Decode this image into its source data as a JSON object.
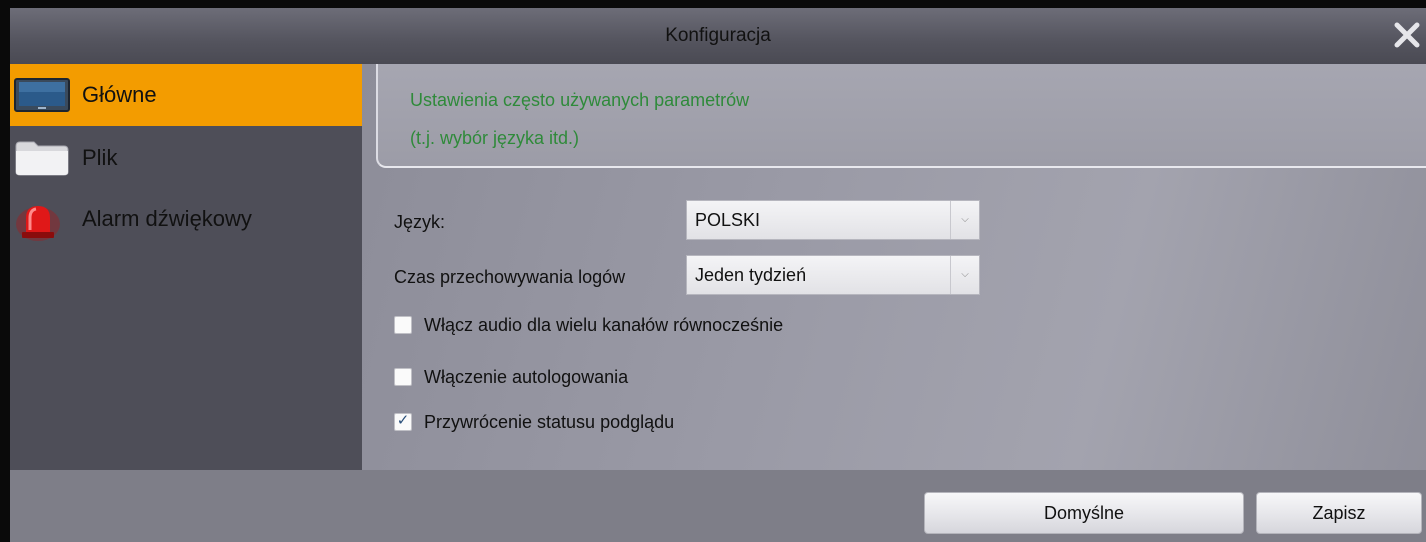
{
  "window": {
    "title": "Konfiguracja",
    "close_icon": "close-icon"
  },
  "sidebar": {
    "items": [
      {
        "label": "Główne",
        "icon": "monitor-icon",
        "active": true
      },
      {
        "label": "Plik",
        "icon": "folder-icon",
        "active": false
      },
      {
        "label": "Alarm dźwiękowy",
        "icon": "alarm-light-icon",
        "active": false
      }
    ]
  },
  "main": {
    "info": {
      "line1": "Ustawienia często używanych parametrów",
      "line2": "(t.j. wybór języka itd.)"
    },
    "language": {
      "label": "Język:",
      "value": "POLSKI"
    },
    "log_retention": {
      "label": "Czas przechowywania logów",
      "value": "Jeden tydzień"
    },
    "checkboxes": [
      {
        "label": "Włącz audio dla wielu kanałów równocześnie",
        "checked": false
      },
      {
        "label": "Włączenie autologowania",
        "checked": false
      },
      {
        "label": "Przywrócenie statusu podglądu",
        "checked": true
      }
    ]
  },
  "footer": {
    "default_label": "Domyślne",
    "save_label": "Zapisz"
  },
  "colors": {
    "accent": "#f39c00",
    "info_text": "#2f8a3a",
    "sidebar_bg": "#4e4e58"
  }
}
